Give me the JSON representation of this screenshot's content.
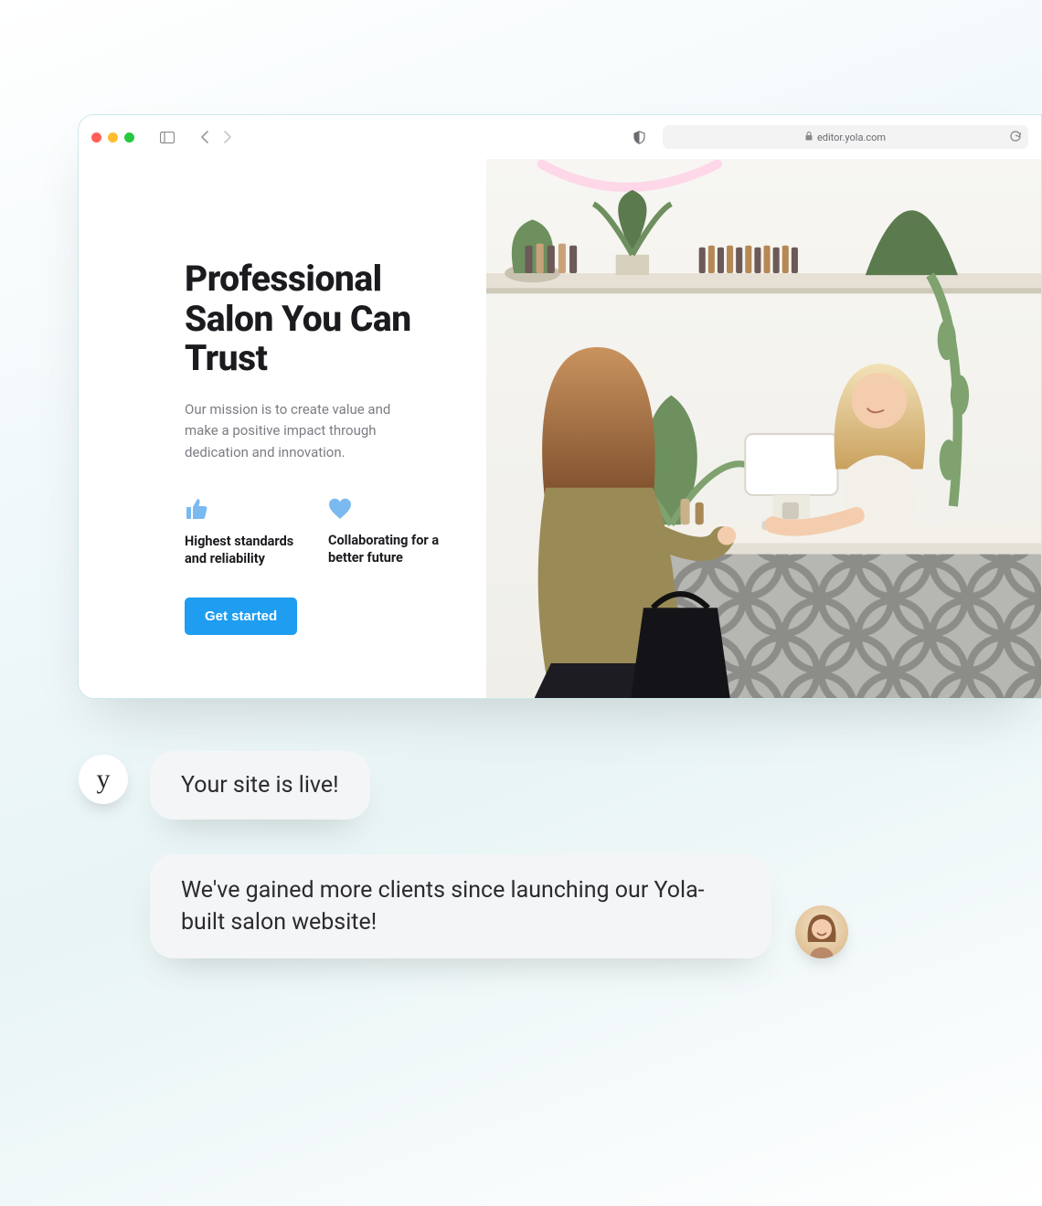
{
  "browser": {
    "url": "editor.yola.com"
  },
  "page": {
    "headline": "Professional Salon You Can Trust",
    "subtext": "Our mission is to create value and make a positive impact through dedication and innovation.",
    "features": [
      {
        "label": "Highest standards and reliability"
      },
      {
        "label": "Collaborating for a better future"
      }
    ],
    "cta_label": "Get started"
  },
  "chat": {
    "bot_avatar_glyph": "y",
    "bot_message": "Your site is live!",
    "user_message": "We've gained more clients since launching our Yola-built salon website!"
  },
  "colors": {
    "accent": "#1e9df1",
    "feature_icon": "#7bbaf0"
  }
}
